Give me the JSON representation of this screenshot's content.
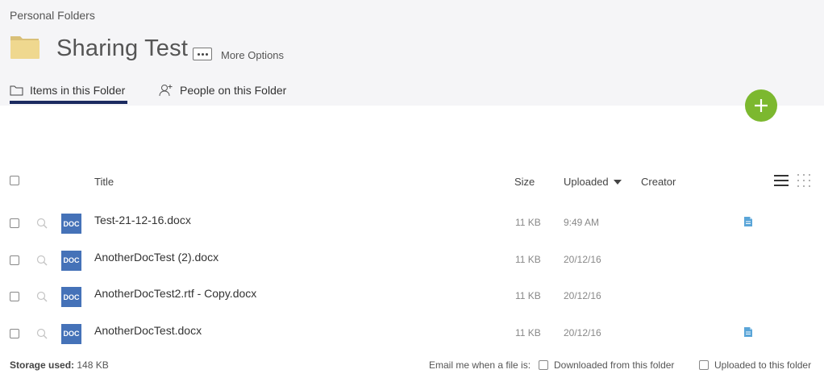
{
  "breadcrumb": "Personal Folders",
  "folder": {
    "title": "Sharing Test",
    "more_options_label": "More Options"
  },
  "tabs": [
    {
      "label": "Items in this Folder",
      "active": true
    },
    {
      "label": "People on this Folder",
      "active": false
    }
  ],
  "table": {
    "columns": {
      "title": "Title",
      "size": "Size",
      "uploaded": "Uploaded",
      "creator": "Creator"
    },
    "sort": {
      "column": "uploaded",
      "direction": "descending"
    },
    "rows": [
      {
        "icon_text": "DOC",
        "title": "Test-21-12-16.docx",
        "size": "11 KB",
        "uploaded": "9:49 AM",
        "has_action_icon": true
      },
      {
        "icon_text": "DOC",
        "title": "AnotherDocTest (2).docx",
        "size": "11 KB",
        "uploaded": "20/12/16",
        "has_action_icon": false
      },
      {
        "icon_text": "DOC",
        "title": "AnotherDocTest2.rtf - Copy.docx",
        "size": "11 KB",
        "uploaded": "20/12/16",
        "has_action_icon": false
      },
      {
        "icon_text": "DOC",
        "title": "AnotherDocTest.docx",
        "size": "11 KB",
        "uploaded": "20/12/16",
        "has_action_icon": true
      }
    ]
  },
  "footer": {
    "storage_label": "Storage used:",
    "storage_value": "148 KB",
    "email_label": "Email me when a file is:",
    "option_downloaded": "Downloaded from this folder",
    "option_uploaded": "Uploaded to this folder"
  },
  "colors": {
    "accent_navy": "#1b2a60",
    "add_button_green": "#7cb82f",
    "doc_icon_blue": "#4572b8",
    "header_background": "#f5f5f7"
  },
  "icons": {
    "folder": "folder-icon",
    "more": "ellipsis-icon",
    "tab_items": "folder-outline-icon",
    "tab_people": "person-add-icon",
    "add": "plus-icon",
    "preview": "magnifier-icon",
    "list_view": "list-view-icon",
    "grid_view": "grid-view-icon",
    "row_action": "file-copy-icon"
  }
}
